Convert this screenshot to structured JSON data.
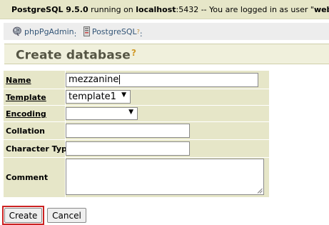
{
  "topbar": {
    "server": "PostgreSQL 9.5.0",
    "running_on": " running on ",
    "host": "localhost",
    "port": ":5432",
    "logged_in_text": " -- You are logged in as user \"",
    "user": "webadmin",
    "end_quote": "\""
  },
  "trail": {
    "app": "phpPgAdmin",
    "app_sep": ":",
    "server": "PostgreSQL",
    "server_help": "?",
    "server_sep": ":"
  },
  "title": {
    "text": "Create database",
    "help": "?"
  },
  "form": {
    "name_label": "Name",
    "name_value": "mezzanine",
    "template_label": "Template",
    "template_value": "template1",
    "encoding_label": "Encoding",
    "encoding_value": "",
    "collation_label": "Collation",
    "collation_value": "",
    "ctype_label": "Character Type",
    "ctype_value": "",
    "comment_label": "Comment",
    "comment_value": ""
  },
  "buttons": {
    "create": "Create",
    "cancel": "Cancel"
  },
  "icons": {
    "app": "elephant-icon",
    "server": "server-icon",
    "resize": "resize-handle-icon",
    "dropdown": "chevron-down-icon"
  }
}
